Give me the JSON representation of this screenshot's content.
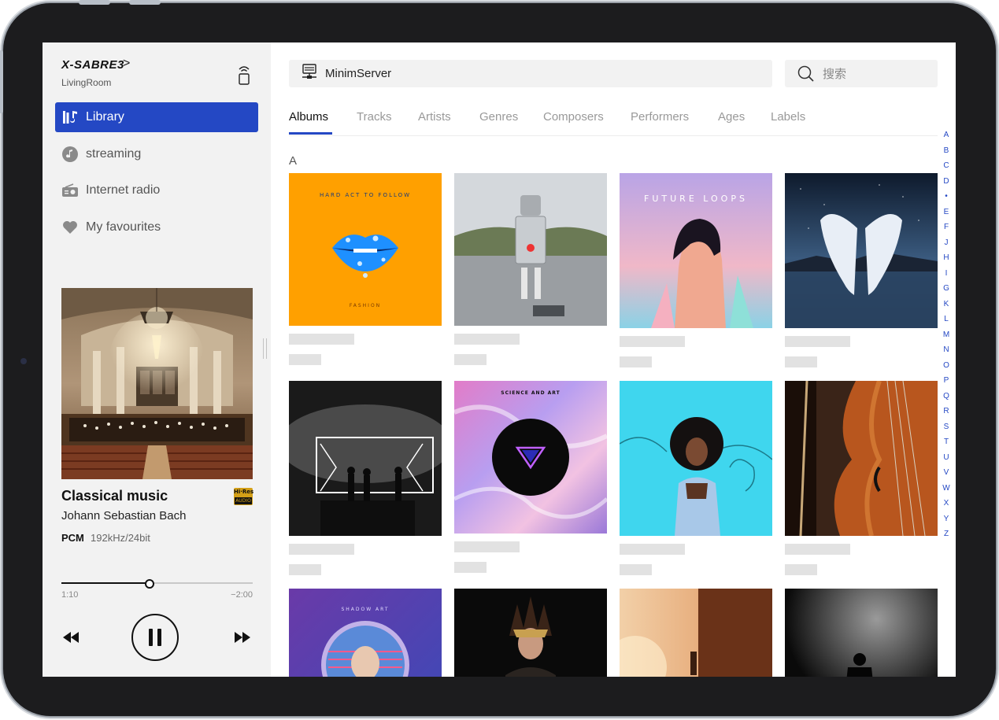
{
  "sidebar": {
    "device_name": "X-SABRE3",
    "device_room": "LivingRoom",
    "nav": [
      {
        "label": "Library",
        "icon": "library-icon",
        "active": true
      },
      {
        "label": "streaming",
        "icon": "music-note-icon",
        "active": false
      },
      {
        "label": "Internet radio",
        "icon": "radio-icon",
        "active": false
      },
      {
        "label": "My favourites",
        "icon": "heart-icon",
        "active": false
      }
    ]
  },
  "now_playing": {
    "title": "Classical music",
    "artist": "Johann Sebastian Bach",
    "badge_top": "Hi·Res",
    "badge_bottom": "AUDIO",
    "format": "PCM",
    "sample_rate": "192kHz/24bit",
    "elapsed": "1:10",
    "remaining": "−2:00",
    "progress_fraction": 0.46
  },
  "main": {
    "source_label": "MinimServer",
    "search_placeholder": "搜索",
    "tabs": [
      "Albums",
      "Tracks",
      "Artists",
      "Genres",
      "Composers",
      "Performers",
      "Ages",
      "Labels"
    ],
    "active_tab": 0,
    "section_letter": "A",
    "albums": [
      {
        "art_text": "HARD ACT TO FOLLOW",
        "art_text2": "FASHION"
      },
      {},
      {
        "art_text": "FUTURE LOOPS"
      },
      {},
      {},
      {
        "art_text": "SCIENCE AND ART"
      },
      {},
      {},
      {
        "art_text": "SHADOW ART"
      },
      {},
      {},
      {}
    ],
    "az_index": [
      "A",
      "B",
      "C",
      "D",
      "•",
      "E",
      "F",
      "J",
      "H",
      "I",
      "G",
      "K",
      "L",
      "M",
      "N",
      "O",
      "P",
      "Q",
      "R",
      "S",
      "T",
      "U",
      "V",
      "W",
      "X",
      "Y",
      "Z"
    ]
  },
  "colors": {
    "accent": "#2448c4",
    "sidebar_bg": "#f2f2f2",
    "hires_gold": "#d4a017"
  }
}
